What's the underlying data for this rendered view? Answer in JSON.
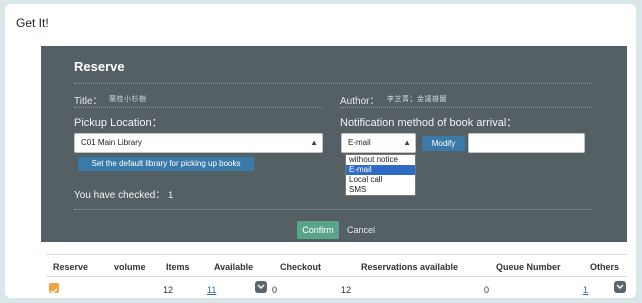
{
  "page_heading": "Get It!",
  "panel": {
    "title": "Reserve",
    "title_label": "Title：",
    "title_value": "蘭桂小杉樹",
    "author_label": "Author：",
    "author_value": "李芝菁；金議雄圖",
    "pickup_location_label": "Pickup Location：",
    "pickup_location_selected": "C01 Main Library",
    "set_default_button": "Set the default library for picking up books",
    "notification_label": "Notification method of book arrival：",
    "notification_selected": "E-mail",
    "notification_options": [
      "without notice",
      "E-mail",
      "Local call",
      "SMS"
    ],
    "modify_button": "Modify",
    "modify_input_value": "",
    "checked_label": "You have checked：",
    "checked_count": "1",
    "confirm_button": "Confirm",
    "cancel_button": "Cancel"
  },
  "table": {
    "headers": [
      "Reserve",
      "volume",
      "Items",
      "Available",
      "Checkout",
      "Reservations available",
      "Queue Number",
      "Others"
    ],
    "row": {
      "reserve_checked": true,
      "volume": "",
      "items": "12",
      "available": "11",
      "checkout": "0",
      "reservations_available": "12",
      "queue_number": "0",
      "others": "1"
    }
  },
  "colors": {
    "panel_bg": "#556064",
    "accent_blue": "#3a7aa8",
    "confirm_green": "#5aa58a",
    "checkbox_orange": "#f0a53c",
    "link_blue": "#2d62b8"
  }
}
